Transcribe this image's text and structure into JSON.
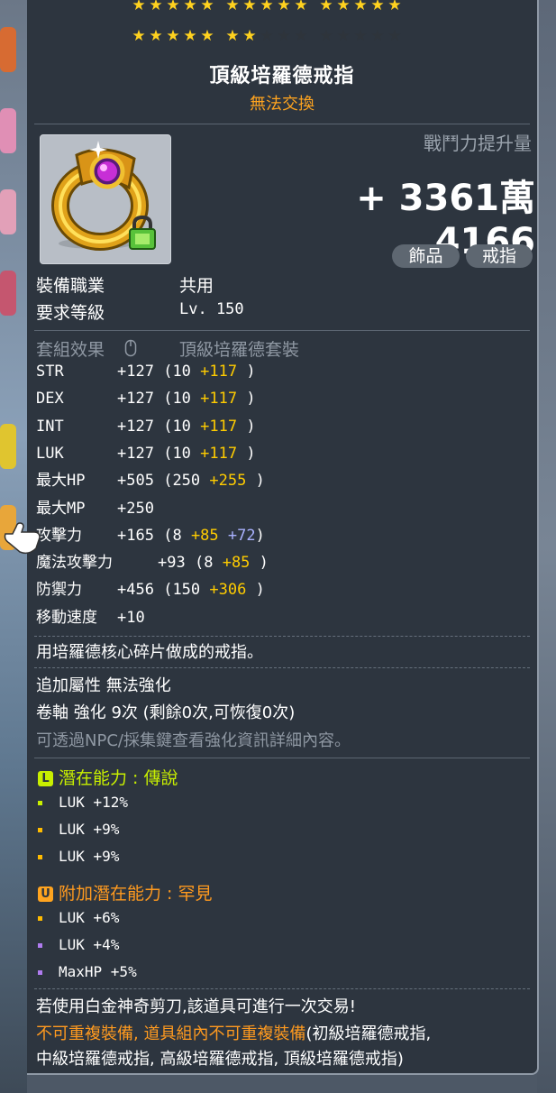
{
  "stars": {
    "row1": [
      5,
      5,
      5
    ],
    "row2": [
      5,
      2,
      0
    ],
    "per_group": 5
  },
  "item": {
    "name": "頂級培羅德戒指",
    "trade_status": "無法交換",
    "icon": "ring-icon",
    "lock_icon": "lock-icon"
  },
  "combat_power": {
    "label": "戰鬥力提升量",
    "value": "+ 3361萬 4166"
  },
  "tags": [
    "飾品",
    "戒指"
  ],
  "requirements": {
    "job_label": "裝備職業",
    "job_value": "共用",
    "level_label": "要求等級",
    "level_value": "Lv. 150"
  },
  "set": {
    "label": "套組效果",
    "name": "頂級培羅德套裝"
  },
  "stats": [
    {
      "name": "STR",
      "total": "+127",
      "base": "(10",
      "bonus": "+117",
      "extra": "",
      "close": ")"
    },
    {
      "name": "DEX",
      "total": "+127",
      "base": "(10",
      "bonus": "+117",
      "extra": "",
      "close": ")"
    },
    {
      "name": "INT",
      "total": "+127",
      "base": "(10",
      "bonus": "+117",
      "extra": "",
      "close": ")"
    },
    {
      "name": "LUK",
      "total": "+127",
      "base": "(10",
      "bonus": "+117",
      "extra": "",
      "close": ")"
    },
    {
      "name": "最大HP",
      "total": "+505",
      "base": "(250",
      "bonus": "+255",
      "extra": "",
      "close": ")"
    },
    {
      "name": "最大MP",
      "total": "+250",
      "base": "",
      "bonus": "",
      "extra": "",
      "close": ""
    },
    {
      "name": "攻擊力",
      "total": "+165",
      "base": "(8",
      "bonus": "+85",
      "extra": "+72",
      "close": ")"
    },
    {
      "name": "魔法攻擊力",
      "total": "+93",
      "base": "(8",
      "bonus": "+85",
      "extra": "",
      "close": ")"
    },
    {
      "name": "防禦力",
      "total": "+456",
      "base": "(150",
      "bonus": "+306",
      "extra": "",
      "close": ")"
    },
    {
      "name": "移動速度",
      "total": "+10",
      "base": "",
      "bonus": "",
      "extra": "",
      "close": ""
    }
  ],
  "description": "用培羅德核心碎片做成的戒指。",
  "enhance": {
    "extra_attr": "追加屬性 無法強化",
    "scroll": "卷軸 強化 9次 (剩餘0次,可恢復0次)",
    "hint": "可透過NPC/採集鍵查看強化資訊詳細內容。"
  },
  "potential": {
    "badge": "L",
    "title": "潛在能力 : 傳說",
    "lines": [
      {
        "text": "LUK +12%",
        "color": "#c8ef00"
      },
      {
        "text": "LUK +9%",
        "color": "#ffbb00"
      },
      {
        "text": "LUK +9%",
        "color": "#ffbb00"
      }
    ]
  },
  "additional_potential": {
    "badge": "U",
    "title": "附加潛在能力 : 罕見",
    "lines": [
      {
        "text": "LUK +6%",
        "color": "#ffbb00"
      },
      {
        "text": "LUK +4%",
        "color": "#b07cf0"
      },
      {
        "text": "MaxHP +5%",
        "color": "#b07cf0"
      }
    ]
  },
  "notes": {
    "scissors": "若使用白金神奇剪刀,該道具可進行一次交易!",
    "unique_warning": "不可重複裝備, 道具組內不可重複裝備",
    "unique_list_a": "(初級培羅德戒指,",
    "unique_list_b": "中級培羅德戒指, 高級培羅德戒指, 頂級培羅德戒指)"
  },
  "colors": {
    "star_on": "#ffd21f",
    "star_off": "#2e343b",
    "trade_orange": "#ffa41f",
    "bonus_yellow": "#ffcc00",
    "extra_blue": "#aab2ff",
    "legend_green": "#c8ef00",
    "rare_orange": "#ff9a1f"
  }
}
